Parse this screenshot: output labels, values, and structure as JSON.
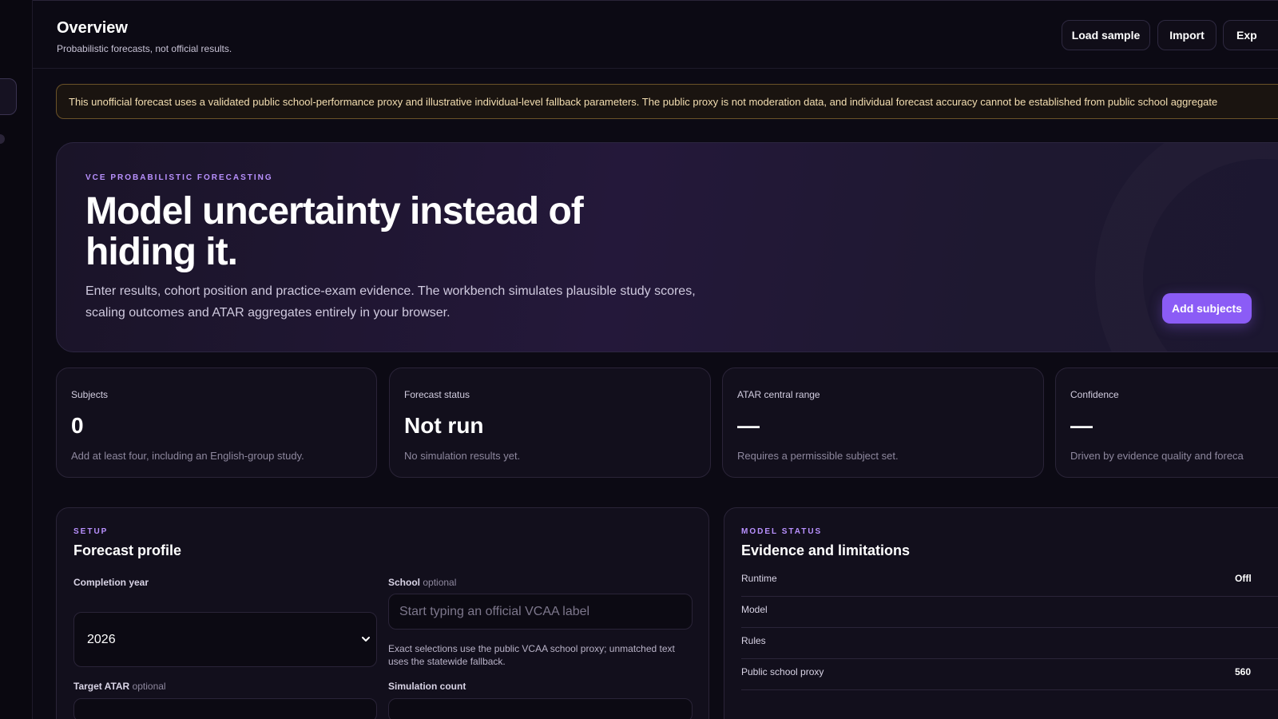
{
  "header": {
    "title": "Overview",
    "subtitle": "Probabilistic forecasts, not official results.",
    "buttons": {
      "load_sample": "Load sample",
      "import": "Import",
      "export": "Exp"
    }
  },
  "banner": {
    "text": "This unofficial forecast uses a validated public school-performance proxy and illustrative individual-level fallback parameters. The public proxy is not moderation data, and individual forecast accuracy cannot be established from public school aggregate"
  },
  "hero": {
    "eyebrow": "VCE PROBABILISTIC FORECASTING",
    "title": "Model uncertainty instead of hiding it.",
    "description": "Enter results, cohort position and practice-exam evidence. The workbench simulates plausible study scores, scaling outcomes and ATAR aggregates entirely in your browser.",
    "cta": "Add subjects"
  },
  "stats": [
    {
      "label": "Subjects",
      "value": "0",
      "note": "Add at least four, including an English-group study."
    },
    {
      "label": "Forecast status",
      "value": "Not run",
      "note": "No simulation results yet."
    },
    {
      "label": "ATAR central range",
      "value": "—",
      "note": "Requires a permissible subject set."
    },
    {
      "label": "Confidence",
      "value": "—",
      "note": "Driven by evidence quality and foreca"
    }
  ],
  "setup": {
    "eyebrow": "SETUP",
    "title": "Forecast profile",
    "completion_year_label": "Completion year",
    "completion_year_value": "2026",
    "school_label": "School",
    "school_optional": "optional",
    "school_placeholder": "Start typing an official VCAA label",
    "school_hint": "Exact selections use the public VCAA school proxy; unmatched text uses the statewide fallback.",
    "target_atar_label": "Target ATAR",
    "target_atar_optional": "optional",
    "simulation_count_label": "Simulation count"
  },
  "model_status": {
    "eyebrow": "MODEL STATUS",
    "title": "Evidence and limitations",
    "rows": [
      {
        "key": "Runtime",
        "value": "Offl"
      },
      {
        "key": "Model",
        "value": ""
      },
      {
        "key": "Rules",
        "value": ""
      },
      {
        "key": "Public school proxy",
        "value": "560"
      }
    ]
  },
  "colors": {
    "accent": "#8b5cf6",
    "eyebrow": "#b991ff",
    "warning_border": "#6b5228"
  }
}
